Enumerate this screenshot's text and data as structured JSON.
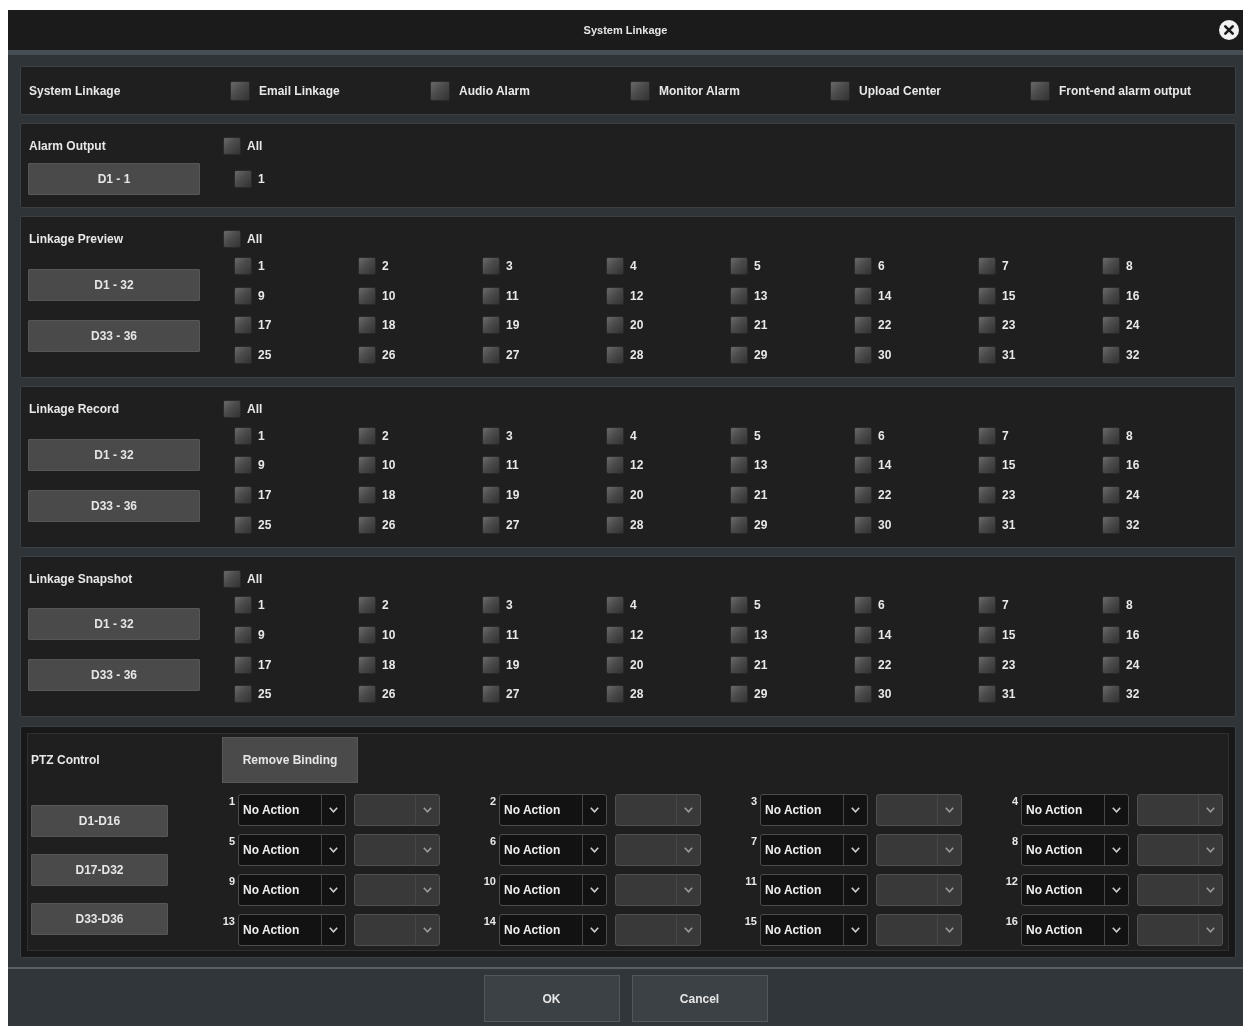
{
  "window": {
    "title": "System Linkage"
  },
  "system_linkage": {
    "label": "System Linkage",
    "options": [
      {
        "label": "Email Linkage",
        "checked": false
      },
      {
        "label": "Audio Alarm",
        "checked": false
      },
      {
        "label": "Monitor Alarm",
        "checked": false
      },
      {
        "label": "Upload Center",
        "checked": false
      },
      {
        "label": "Front-end alarm output",
        "checked": false
      }
    ]
  },
  "sections": [
    {
      "title": "Alarm Output",
      "all": {
        "label": "All",
        "checked": false
      },
      "ranges": [
        "D1 - 1"
      ],
      "channels": [
        {
          "label": "1",
          "checked": false
        }
      ]
    },
    {
      "title": "Linkage Preview",
      "all": {
        "label": "All",
        "checked": false
      },
      "ranges": [
        "D1 - 32",
        "D33 - 36"
      ],
      "channels": [
        {
          "label": "1",
          "checked": false
        },
        {
          "label": "2",
          "checked": false
        },
        {
          "label": "3",
          "checked": false
        },
        {
          "label": "4",
          "checked": false
        },
        {
          "label": "5",
          "checked": false
        },
        {
          "label": "6",
          "checked": false
        },
        {
          "label": "7",
          "checked": false
        },
        {
          "label": "8",
          "checked": false
        },
        {
          "label": "9",
          "checked": false
        },
        {
          "label": "10",
          "checked": false
        },
        {
          "label": "11",
          "checked": false
        },
        {
          "label": "12",
          "checked": false
        },
        {
          "label": "13",
          "checked": false
        },
        {
          "label": "14",
          "checked": false
        },
        {
          "label": "15",
          "checked": false
        },
        {
          "label": "16",
          "checked": false
        },
        {
          "label": "17",
          "checked": false
        },
        {
          "label": "18",
          "checked": false
        },
        {
          "label": "19",
          "checked": false
        },
        {
          "label": "20",
          "checked": false
        },
        {
          "label": "21",
          "checked": false
        },
        {
          "label": "22",
          "checked": false
        },
        {
          "label": "23",
          "checked": false
        },
        {
          "label": "24",
          "checked": false
        },
        {
          "label": "25",
          "checked": false
        },
        {
          "label": "26",
          "checked": false
        },
        {
          "label": "27",
          "checked": false
        },
        {
          "label": "28",
          "checked": false
        },
        {
          "label": "29",
          "checked": false
        },
        {
          "label": "30",
          "checked": false
        },
        {
          "label": "31",
          "checked": false
        },
        {
          "label": "32",
          "checked": false
        }
      ]
    },
    {
      "title": "Linkage Record",
      "all": {
        "label": "All",
        "checked": false
      },
      "ranges": [
        "D1 - 32",
        "D33 - 36"
      ],
      "channels": [
        {
          "label": "1",
          "checked": false
        },
        {
          "label": "2",
          "checked": false
        },
        {
          "label": "3",
          "checked": false
        },
        {
          "label": "4",
          "checked": false
        },
        {
          "label": "5",
          "checked": false
        },
        {
          "label": "6",
          "checked": false
        },
        {
          "label": "7",
          "checked": false
        },
        {
          "label": "8",
          "checked": false
        },
        {
          "label": "9",
          "checked": false
        },
        {
          "label": "10",
          "checked": false
        },
        {
          "label": "11",
          "checked": false
        },
        {
          "label": "12",
          "checked": false
        },
        {
          "label": "13",
          "checked": false
        },
        {
          "label": "14",
          "checked": false
        },
        {
          "label": "15",
          "checked": false
        },
        {
          "label": "16",
          "checked": false
        },
        {
          "label": "17",
          "checked": false
        },
        {
          "label": "18",
          "checked": false
        },
        {
          "label": "19",
          "checked": false
        },
        {
          "label": "20",
          "checked": false
        },
        {
          "label": "21",
          "checked": false
        },
        {
          "label": "22",
          "checked": false
        },
        {
          "label": "23",
          "checked": false
        },
        {
          "label": "24",
          "checked": false
        },
        {
          "label": "25",
          "checked": false
        },
        {
          "label": "26",
          "checked": false
        },
        {
          "label": "27",
          "checked": false
        },
        {
          "label": "28",
          "checked": false
        },
        {
          "label": "29",
          "checked": false
        },
        {
          "label": "30",
          "checked": false
        },
        {
          "label": "31",
          "checked": false
        },
        {
          "label": "32",
          "checked": false
        }
      ]
    },
    {
      "title": "Linkage Snapshot",
      "all": {
        "label": "All",
        "checked": false
      },
      "ranges": [
        "D1 - 32",
        "D33 - 36"
      ],
      "channels": [
        {
          "label": "1",
          "checked": false
        },
        {
          "label": "2",
          "checked": false
        },
        {
          "label": "3",
          "checked": false
        },
        {
          "label": "4",
          "checked": false
        },
        {
          "label": "5",
          "checked": false
        },
        {
          "label": "6",
          "checked": false
        },
        {
          "label": "7",
          "checked": false
        },
        {
          "label": "8",
          "checked": false
        },
        {
          "label": "9",
          "checked": false
        },
        {
          "label": "10",
          "checked": false
        },
        {
          "label": "11",
          "checked": false
        },
        {
          "label": "12",
          "checked": false
        },
        {
          "label": "13",
          "checked": false
        },
        {
          "label": "14",
          "checked": false
        },
        {
          "label": "15",
          "checked": false
        },
        {
          "label": "16",
          "checked": false
        },
        {
          "label": "17",
          "checked": false
        },
        {
          "label": "18",
          "checked": false
        },
        {
          "label": "19",
          "checked": false
        },
        {
          "label": "20",
          "checked": false
        },
        {
          "label": "21",
          "checked": false
        },
        {
          "label": "22",
          "checked": false
        },
        {
          "label": "23",
          "checked": false
        },
        {
          "label": "24",
          "checked": false
        },
        {
          "label": "25",
          "checked": false
        },
        {
          "label": "26",
          "checked": false
        },
        {
          "label": "27",
          "checked": false
        },
        {
          "label": "28",
          "checked": false
        },
        {
          "label": "29",
          "checked": false
        },
        {
          "label": "30",
          "checked": false
        },
        {
          "label": "31",
          "checked": false
        },
        {
          "label": "32",
          "checked": false
        }
      ]
    }
  ],
  "ptz": {
    "title": "PTZ Control",
    "remove_button": "Remove Binding",
    "ranges": [
      "D1-D16",
      "D17-D32",
      "D33-D36"
    ],
    "channels": [
      {
        "number": "1",
        "action": "No Action",
        "preset_disabled": true
      },
      {
        "number": "2",
        "action": "No Action",
        "preset_disabled": true
      },
      {
        "number": "3",
        "action": "No Action",
        "preset_disabled": true
      },
      {
        "number": "4",
        "action": "No Action",
        "preset_disabled": true
      },
      {
        "number": "5",
        "action": "No Action",
        "preset_disabled": true
      },
      {
        "number": "6",
        "action": "No Action",
        "preset_disabled": true
      },
      {
        "number": "7",
        "action": "No Action",
        "preset_disabled": true
      },
      {
        "number": "8",
        "action": "No Action",
        "preset_disabled": true
      },
      {
        "number": "9",
        "action": "No Action",
        "preset_disabled": true
      },
      {
        "number": "10",
        "action": "No Action",
        "preset_disabled": true
      },
      {
        "number": "11",
        "action": "No Action",
        "preset_disabled": true
      },
      {
        "number": "12",
        "action": "No Action",
        "preset_disabled": true
      },
      {
        "number": "13",
        "action": "No Action",
        "preset_disabled": true
      },
      {
        "number": "14",
        "action": "No Action",
        "preset_disabled": true
      },
      {
        "number": "15",
        "action": "No Action",
        "preset_disabled": true
      },
      {
        "number": "16",
        "action": "No Action",
        "preset_disabled": true
      }
    ]
  },
  "buttons": [
    "OK",
    "Cancel"
  ]
}
